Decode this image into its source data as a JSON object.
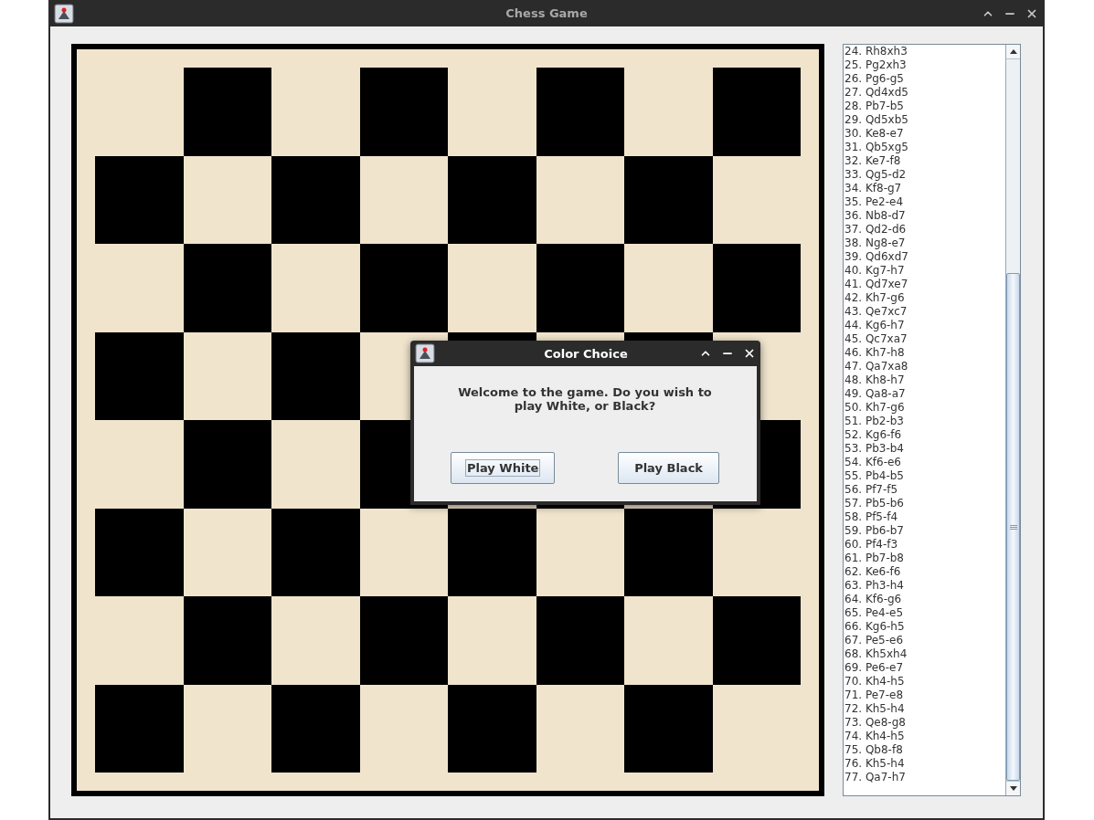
{
  "window": {
    "title": "Chess Game"
  },
  "moves": [
    "24. Rh8xh3",
    "25. Pg2xh3",
    "26. Pg6-g5",
    "27. Qd4xd5",
    "28. Pb7-b5",
    "29. Qd5xb5",
    "30. Ke8-e7",
    "31. Qb5xg5",
    "32. Ke7-f8",
    "33. Qg5-d2",
    "34. Kf8-g7",
    "35. Pe2-e4",
    "36. Nb8-d7",
    "37. Qd2-d6",
    "38. Ng8-e7",
    "39. Qd6xd7",
    "40. Kg7-h7",
    "41. Qd7xe7",
    "42. Kh7-g6",
    "43. Qe7xc7",
    "44. Kg6-h7",
    "45. Qc7xa7",
    "46. Kh7-h8",
    "47. Qa7xa8",
    "48. Kh8-h7",
    "49. Qa8-a7",
    "50. Kh7-g6",
    "51. Pb2-b3",
    "52. Kg6-f6",
    "53. Pb3-b4",
    "54. Kf6-e6",
    "55. Pb4-b5",
    "56. Pf7-f5",
    "57. Pb5-b6",
    "58. Pf5-f4",
    "59. Pb6-b7",
    "60. Pf4-f3",
    "61. Pb7-b8",
    "62. Ke6-f6",
    "63. Ph3-h4",
    "64. Kf6-g6",
    "65. Pe4-e5",
    "66. Kg6-h5",
    "67. Pe5-e6",
    "68. Kh5xh4",
    "69. Pe6-e7",
    "70. Kh4-h5",
    "71. Pe7-e8",
    "72. Kh5-h4",
    "73. Qe8-g8",
    "74. Kh4-h5",
    "75. Qb8-f8",
    "76. Kh5-h4",
    "77. Qa7-h7"
  ],
  "dialog": {
    "title": "Color Choice",
    "message": "Welcome to the game. Do you wish to play White, or Black?",
    "buttons": [
      {
        "label": "Play White",
        "focused": true
      },
      {
        "label": "Play Black",
        "focused": false
      }
    ]
  }
}
